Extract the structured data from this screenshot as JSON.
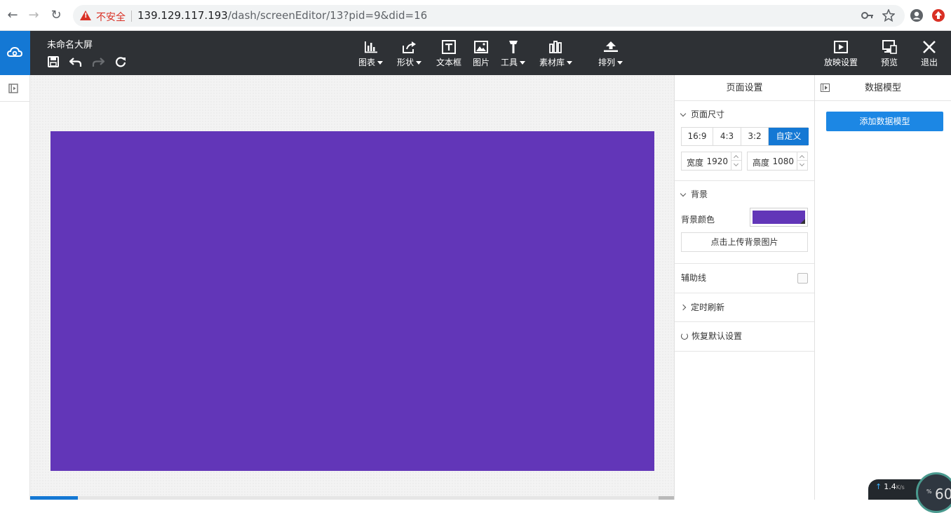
{
  "browser": {
    "insecure_label": "不安全",
    "url_host": "139.129.117.193",
    "url_path": "/dash/screenEditor/13?pid=9&did=16"
  },
  "app": {
    "doc_title": "未命名大屏",
    "tools": [
      {
        "label": "图表",
        "icon": "bar-chart-icon",
        "dropdown": true
      },
      {
        "label": "形状",
        "icon": "shape-icon",
        "dropdown": true
      },
      {
        "label": "文本框",
        "icon": "textbox-icon",
        "dropdown": false
      },
      {
        "label": "图片",
        "icon": "image-icon",
        "dropdown": false
      },
      {
        "label": "工具",
        "icon": "hammer-icon",
        "dropdown": true
      },
      {
        "label": "素材库",
        "icon": "library-icon",
        "dropdown": true
      },
      {
        "label": "排列",
        "icon": "arrange-icon",
        "dropdown": true
      }
    ],
    "right_actions": [
      {
        "label": "放映设置",
        "icon": "play-icon"
      },
      {
        "label": "预览",
        "icon": "preview-icon"
      },
      {
        "label": "退出",
        "icon": "close-icon"
      }
    ]
  },
  "canvas": {
    "background_color": "#6236b8"
  },
  "settings": {
    "title": "页面设置",
    "page_size": {
      "title": "页面尺寸",
      "ratios": [
        "16:9",
        "4:3",
        "3:2",
        "自定义"
      ],
      "active_ratio": "自定义",
      "width_label": "宽度",
      "width_value": "1920",
      "height_label": "高度",
      "height_value": "1080"
    },
    "background": {
      "title": "背景",
      "color_label": "背景颜色",
      "color_value": "#6236b8",
      "upload_label": "点击上传背景图片"
    },
    "guides_label": "辅助线",
    "guides_checked": false,
    "timed_refresh_label": "定时刷新",
    "restore_label": "恢复默认设置"
  },
  "data_model": {
    "title": "数据模型",
    "add_button": "添加数据模型"
  },
  "net_widget": {
    "speed": "1.4",
    "speed_unit": "K/s",
    "percent": "60",
    "percent_unit": "%"
  }
}
